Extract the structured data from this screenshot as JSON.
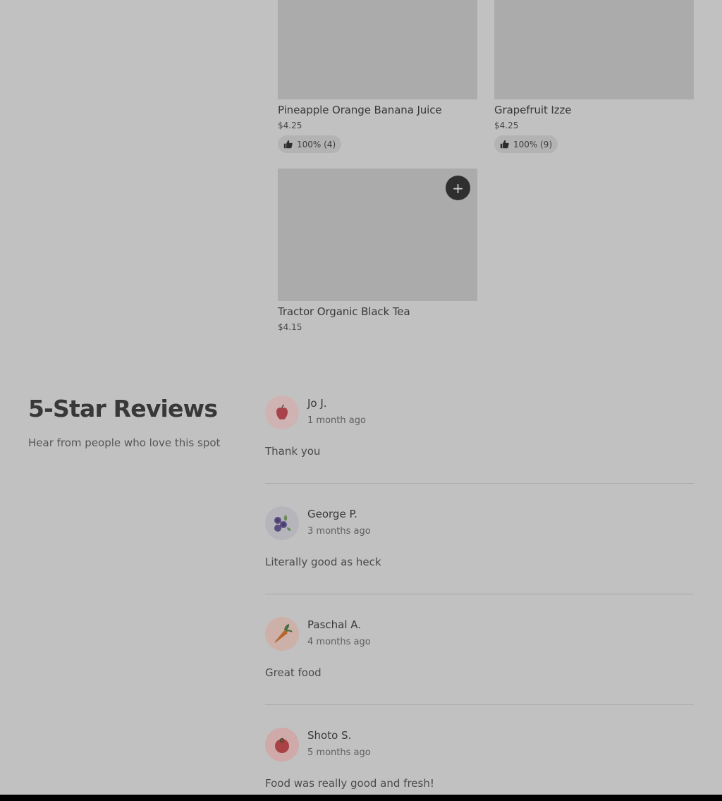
{
  "products": [
    {
      "name": "Pineapple Orange Banana Juice",
      "price": "$4.25",
      "rating": "100% (4)"
    },
    {
      "name": "Grapefruit Izze",
      "price": "$4.25",
      "rating": "100% (9)"
    },
    {
      "name": "Tractor Organic Black Tea",
      "price": "$4.15",
      "add_label": "+"
    }
  ],
  "reviews_section": {
    "title": "5-Star Reviews",
    "subtitle": "Hear from people who love this spot"
  },
  "reviews": [
    {
      "name": "Jo J.",
      "date": "1 month ago",
      "text": "Thank you",
      "avatar_icon": "apple-icon"
    },
    {
      "name": "George P.",
      "date": "3 months ago",
      "text": "Literally good as heck",
      "avatar_icon": "blueberries-icon"
    },
    {
      "name": "Paschal A.",
      "date": "4 months ago",
      "text": "Great food",
      "avatar_icon": "carrot-icon"
    },
    {
      "name": "Shoto S.",
      "date": "5 months ago",
      "text": "Food was really good and fresh!",
      "avatar_icon": "tomato-icon"
    }
  ],
  "colors": {
    "overlay_background": "#c1c1c1",
    "image_placeholder": "#ababab",
    "add_button": "#2f2f2f"
  }
}
